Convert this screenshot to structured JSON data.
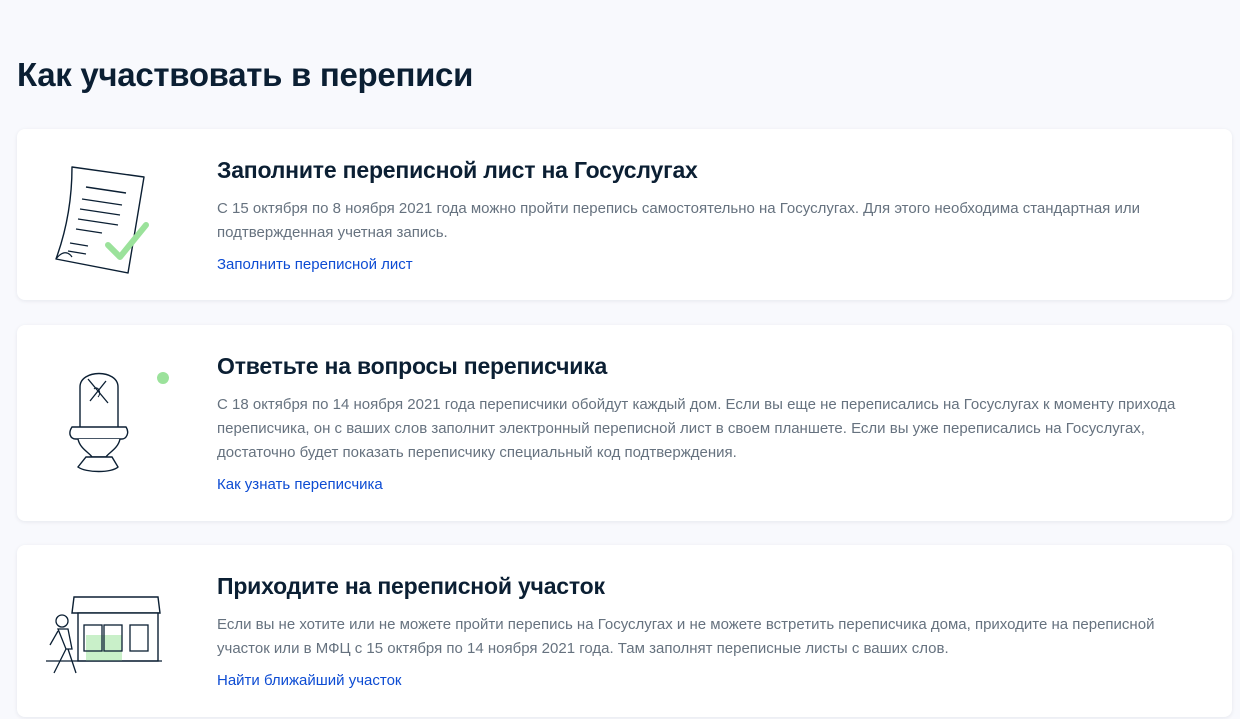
{
  "page": {
    "title": "Как участвовать в переписи"
  },
  "colors": {
    "background": "#f8f9fd",
    "card": "#ffffff",
    "title": "#0b1f33",
    "text": "#66727f",
    "link": "#0d4cd3",
    "accent_green": "#9be29b"
  },
  "cards": [
    {
      "icon": "census-form-checkmark-icon",
      "title": "Заполните переписной лист на Госуслугах",
      "text": "С 15 октября по 8 ноября 2021 года можно пройти перепись самостоятельно на Госуслугах. Для этого необходима стандартная или подтвержденная учетная запись.",
      "link": "Заполнить переписной лист"
    },
    {
      "icon": "census-taker-bell-icon",
      "title": "Ответьте на вопросы переписчика",
      "text": "С 18 октября по 14 ноября 2021 года переписчики обойдут каждый дом. Если вы еще не переписались на Госуслугах к моменту прихода переписчика, он с ваших слов заполнит электронный переписной лист в своем планшете. Если вы уже переписались на Госуслугах, достаточно будет показать переписчику специальный код подтверждения.",
      "link": "Как узнать переписчика"
    },
    {
      "icon": "census-station-building-icon",
      "title": "Приходите на переписной участок",
      "text": "Если вы не хотите или не можете пройти перепись на Госуслугах и не можете встретить переписчика дома, приходите на переписной участок или в МФЦ с 15 октября по 14 ноября 2021 года. Там заполнят переписные листы с ваших слов.",
      "link": "Найти ближайший участок"
    }
  ]
}
